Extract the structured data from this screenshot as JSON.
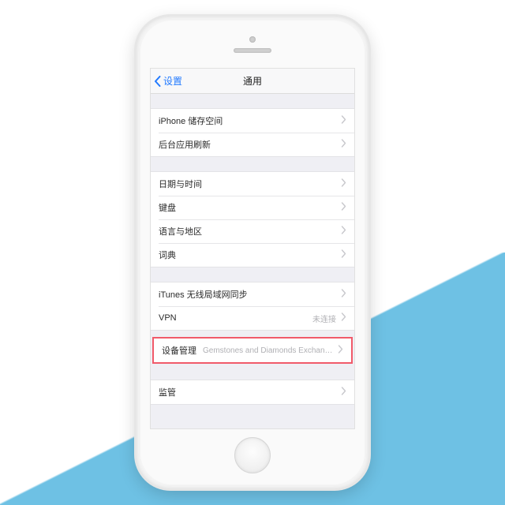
{
  "nav": {
    "back_label": "设置",
    "title": "通用"
  },
  "groups": [
    {
      "rows": [
        {
          "label": "iPhone 储存空间",
          "value": ""
        },
        {
          "label": "后台应用刷新",
          "value": ""
        }
      ]
    },
    {
      "rows": [
        {
          "label": "日期与时间",
          "value": ""
        },
        {
          "label": "键盘",
          "value": ""
        },
        {
          "label": "语言与地区",
          "value": ""
        },
        {
          "label": "词典",
          "value": ""
        }
      ]
    },
    {
      "rows": [
        {
          "label": "iTunes 无线局域网同步",
          "value": ""
        },
        {
          "label": "VPN",
          "value": "未连接"
        }
      ]
    }
  ],
  "highlight": {
    "label": "设备管理",
    "value": "Gemstones and Diamonds Exchange..."
  },
  "last_group": {
    "rows": [
      {
        "label": "监管",
        "value": ""
      }
    ]
  }
}
